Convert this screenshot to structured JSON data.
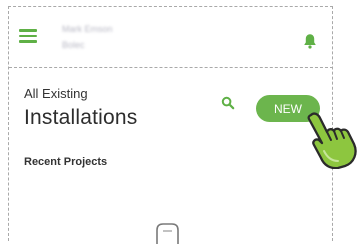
{
  "colors": {
    "accent": "#5fb046",
    "button_bg": "#6cb54d",
    "text_dark": "#2d2d2d",
    "blurred_text": "#b8b8c4",
    "border": "#a9a9a9"
  },
  "header": {
    "menu_icon": "hamburger-icon",
    "user_name": "Mark Emson",
    "company": "Bolec",
    "notification_icon": "bell-icon"
  },
  "installations": {
    "pre_title": "All Existing",
    "title": "Installations",
    "search_icon": "search-icon",
    "new_label": "NEW"
  },
  "recent": {
    "heading": "Recent Projects"
  },
  "overlay": {
    "pointer_icon": "pointing-hand-icon"
  }
}
